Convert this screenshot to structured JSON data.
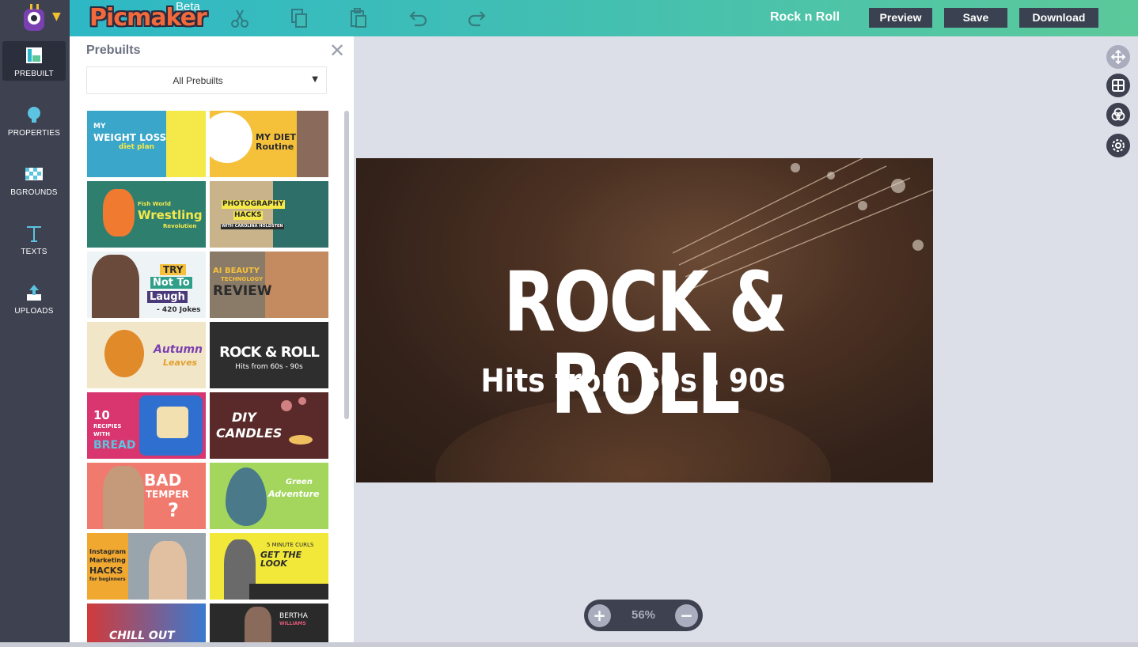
{
  "app": {
    "logo": "Picmaker",
    "beta": "Beta",
    "doc_title": "Rock n Roll"
  },
  "toolbar": {
    "icons": [
      "cut-icon",
      "copy-icon",
      "paste-icon",
      "undo-icon",
      "redo-icon"
    ],
    "preview_label": "Preview",
    "save_label": "Save",
    "download_label": "Download"
  },
  "sidebar": {
    "items": [
      {
        "label": "PREBUILT",
        "icon": "prebuilt-icon",
        "active": true
      },
      {
        "label": "PROPERTIES",
        "icon": "lightbulb-icon",
        "active": false
      },
      {
        "label": "BGROUNDS",
        "icon": "checker-icon",
        "active": false
      },
      {
        "label": "TEXTS",
        "icon": "text-icon",
        "active": false
      },
      {
        "label": "UPLOADS",
        "icon": "upload-icon",
        "active": false
      }
    ]
  },
  "panel": {
    "title": "Prebuilts",
    "filter_value": "All Prebuilts",
    "thumbnails": [
      {
        "lines": [
          "MY",
          "WEIGHT LOSS",
          "diet plan"
        ],
        "bg": "#3aa6c9"
      },
      {
        "lines": [
          "MY DIET",
          "Routine"
        ],
        "bg": "#f5c13b"
      },
      {
        "lines": [
          "Fish World",
          "Wrestling",
          "Revolution"
        ],
        "bg": "#2f7f6f"
      },
      {
        "lines": [
          "PHOTOGRAPHY",
          "HACKS",
          "WITH CAROLINA HOLDSTEN"
        ],
        "bg": "#c9b38a"
      },
      {
        "lines": [
          "TRY",
          "Not To",
          "Laugh",
          "- 420 Jokes"
        ],
        "bg": "#eef3f6"
      },
      {
        "lines": [
          "AI BEAUTY",
          "TECHNOLOGY",
          "REVIEW"
        ],
        "bg": "#8a7a68"
      },
      {
        "lines": [
          "Autumn",
          "Leaves"
        ],
        "bg": "#f2e6c8"
      },
      {
        "lines": [
          "ROCK & ROLL",
          "Hits from 60s - 90s"
        ],
        "bg": "#2e2e2e"
      },
      {
        "lines": [
          "10",
          "RECIPIES",
          "WITH",
          "BREAD"
        ],
        "bg": "#d9356e"
      },
      {
        "lines": [
          "DIY",
          "CANDLES"
        ],
        "bg": "#5a2a2a"
      },
      {
        "lines": [
          "BAD",
          "TEMPER",
          "?"
        ],
        "bg": "#f07a6e"
      },
      {
        "lines": [
          "Green",
          "Adventure"
        ],
        "bg": "#a4d65e"
      },
      {
        "lines": [
          "Instagram",
          "Marketing",
          "HACKS",
          "for beginners"
        ],
        "bg": "#9aa4ad"
      },
      {
        "lines": [
          "5 MINUTE CURLS",
          "GET THE LOOK"
        ],
        "bg": "#f1e83a"
      },
      {
        "lines": [
          "CHILL OUT"
        ],
        "bg": "#d23a3a"
      },
      {
        "lines": [
          "BERTHA",
          "WILLIAMS"
        ],
        "bg": "#2a2a2a"
      }
    ]
  },
  "canvas": {
    "title": "ROCK & ROLL",
    "subtitle": "Hits from 60s - 90s"
  },
  "right_tools": [
    "move-icon",
    "grid-icon",
    "layers-icon",
    "settings-icon"
  ],
  "zoom": {
    "plus": "+",
    "value": "56%",
    "minus": "−"
  }
}
